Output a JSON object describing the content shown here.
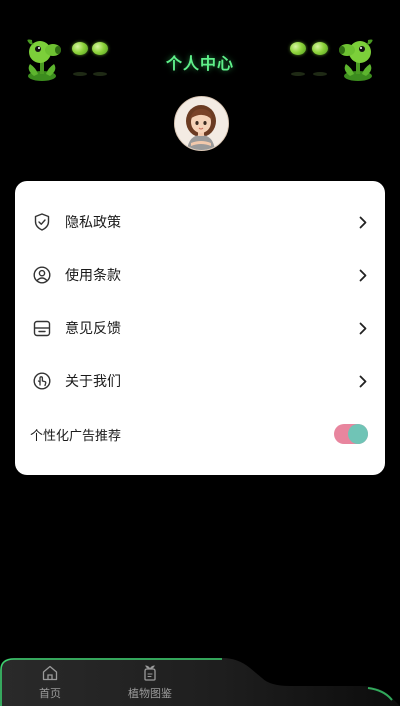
{
  "header": {
    "title": "个人中心",
    "title_color": "#5ff08a"
  },
  "profile": {
    "avatar_icon": "avatar-girl"
  },
  "menu": {
    "items": [
      {
        "label": "隐私政策",
        "icon": "shield-icon"
      },
      {
        "label": "使用条款",
        "icon": "user-circle-icon"
      },
      {
        "label": "意见反馈",
        "icon": "feedback-box-icon"
      },
      {
        "label": "关于我们",
        "icon": "hand-pointer-icon"
      }
    ],
    "ad_setting": {
      "label": "个性化广告推荐",
      "enabled": true,
      "track_color": "#e8859e",
      "knob_color": "#70c4b6"
    }
  },
  "bottom_nav": {
    "items": [
      {
        "label": "首页",
        "icon": "home-icon"
      },
      {
        "label": "植物图鉴",
        "icon": "plant-book-icon"
      }
    ],
    "accent_color": "#3bd16f"
  }
}
